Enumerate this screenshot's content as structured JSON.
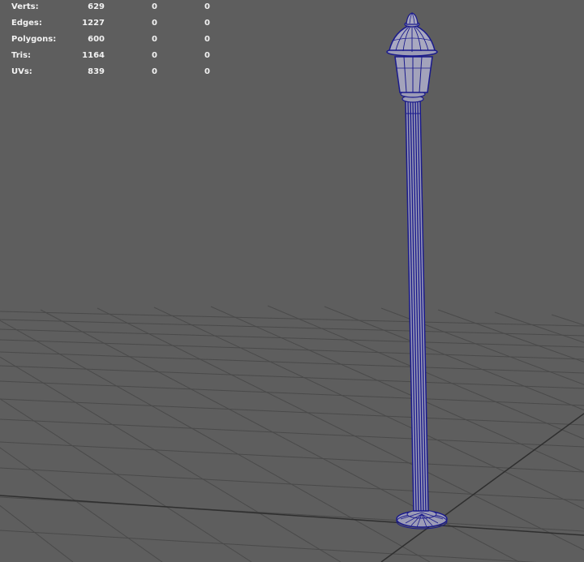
{
  "hud": {
    "rows": [
      {
        "label": "Verts:",
        "v1": "629",
        "v2": "0",
        "v3": "0"
      },
      {
        "label": "Edges:",
        "v1": "1227",
        "v2": "0",
        "v3": "0"
      },
      {
        "label": "Polygons:",
        "v1": "600",
        "v2": "0",
        "v3": "0"
      },
      {
        "label": "Tris:",
        "v1": "1164",
        "v2": "0",
        "v3": "0"
      },
      {
        "label": "UVs:",
        "v1": "839",
        "v2": "0",
        "v3": "0"
      }
    ]
  },
  "colors": {
    "background": "#5e5e5e",
    "grid": "#4a4a4a",
    "grid_axis": "#2f2f2f",
    "wire": "#1a1a8c",
    "mesh_fill": "#9c9cb6",
    "hud_text": "#f2f2f2"
  }
}
